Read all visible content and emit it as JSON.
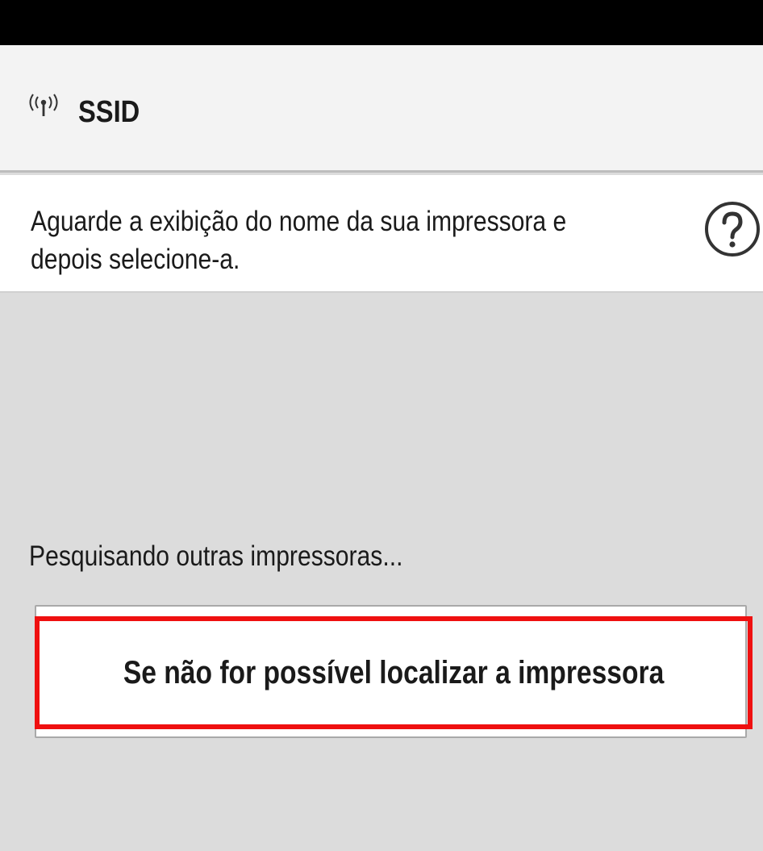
{
  "header": {
    "ssid_label": "SSID",
    "ssid_icon": "wireless-signal-icon"
  },
  "instruction": {
    "line1": "Aguarde a exibição do nome da sua impressora e",
    "line2": "depois selecione-a.",
    "help_icon": "help-circle-icon"
  },
  "search": {
    "status_text": "Pesquisando outras impressoras..."
  },
  "cannot_find": {
    "button_label": "Se não for possível localizar a impressora"
  },
  "colors": {
    "status_bar": "#000000",
    "header_bg": "#f3f3f3",
    "content_bg": "#dcdcdc",
    "highlight": "#ef1010"
  }
}
